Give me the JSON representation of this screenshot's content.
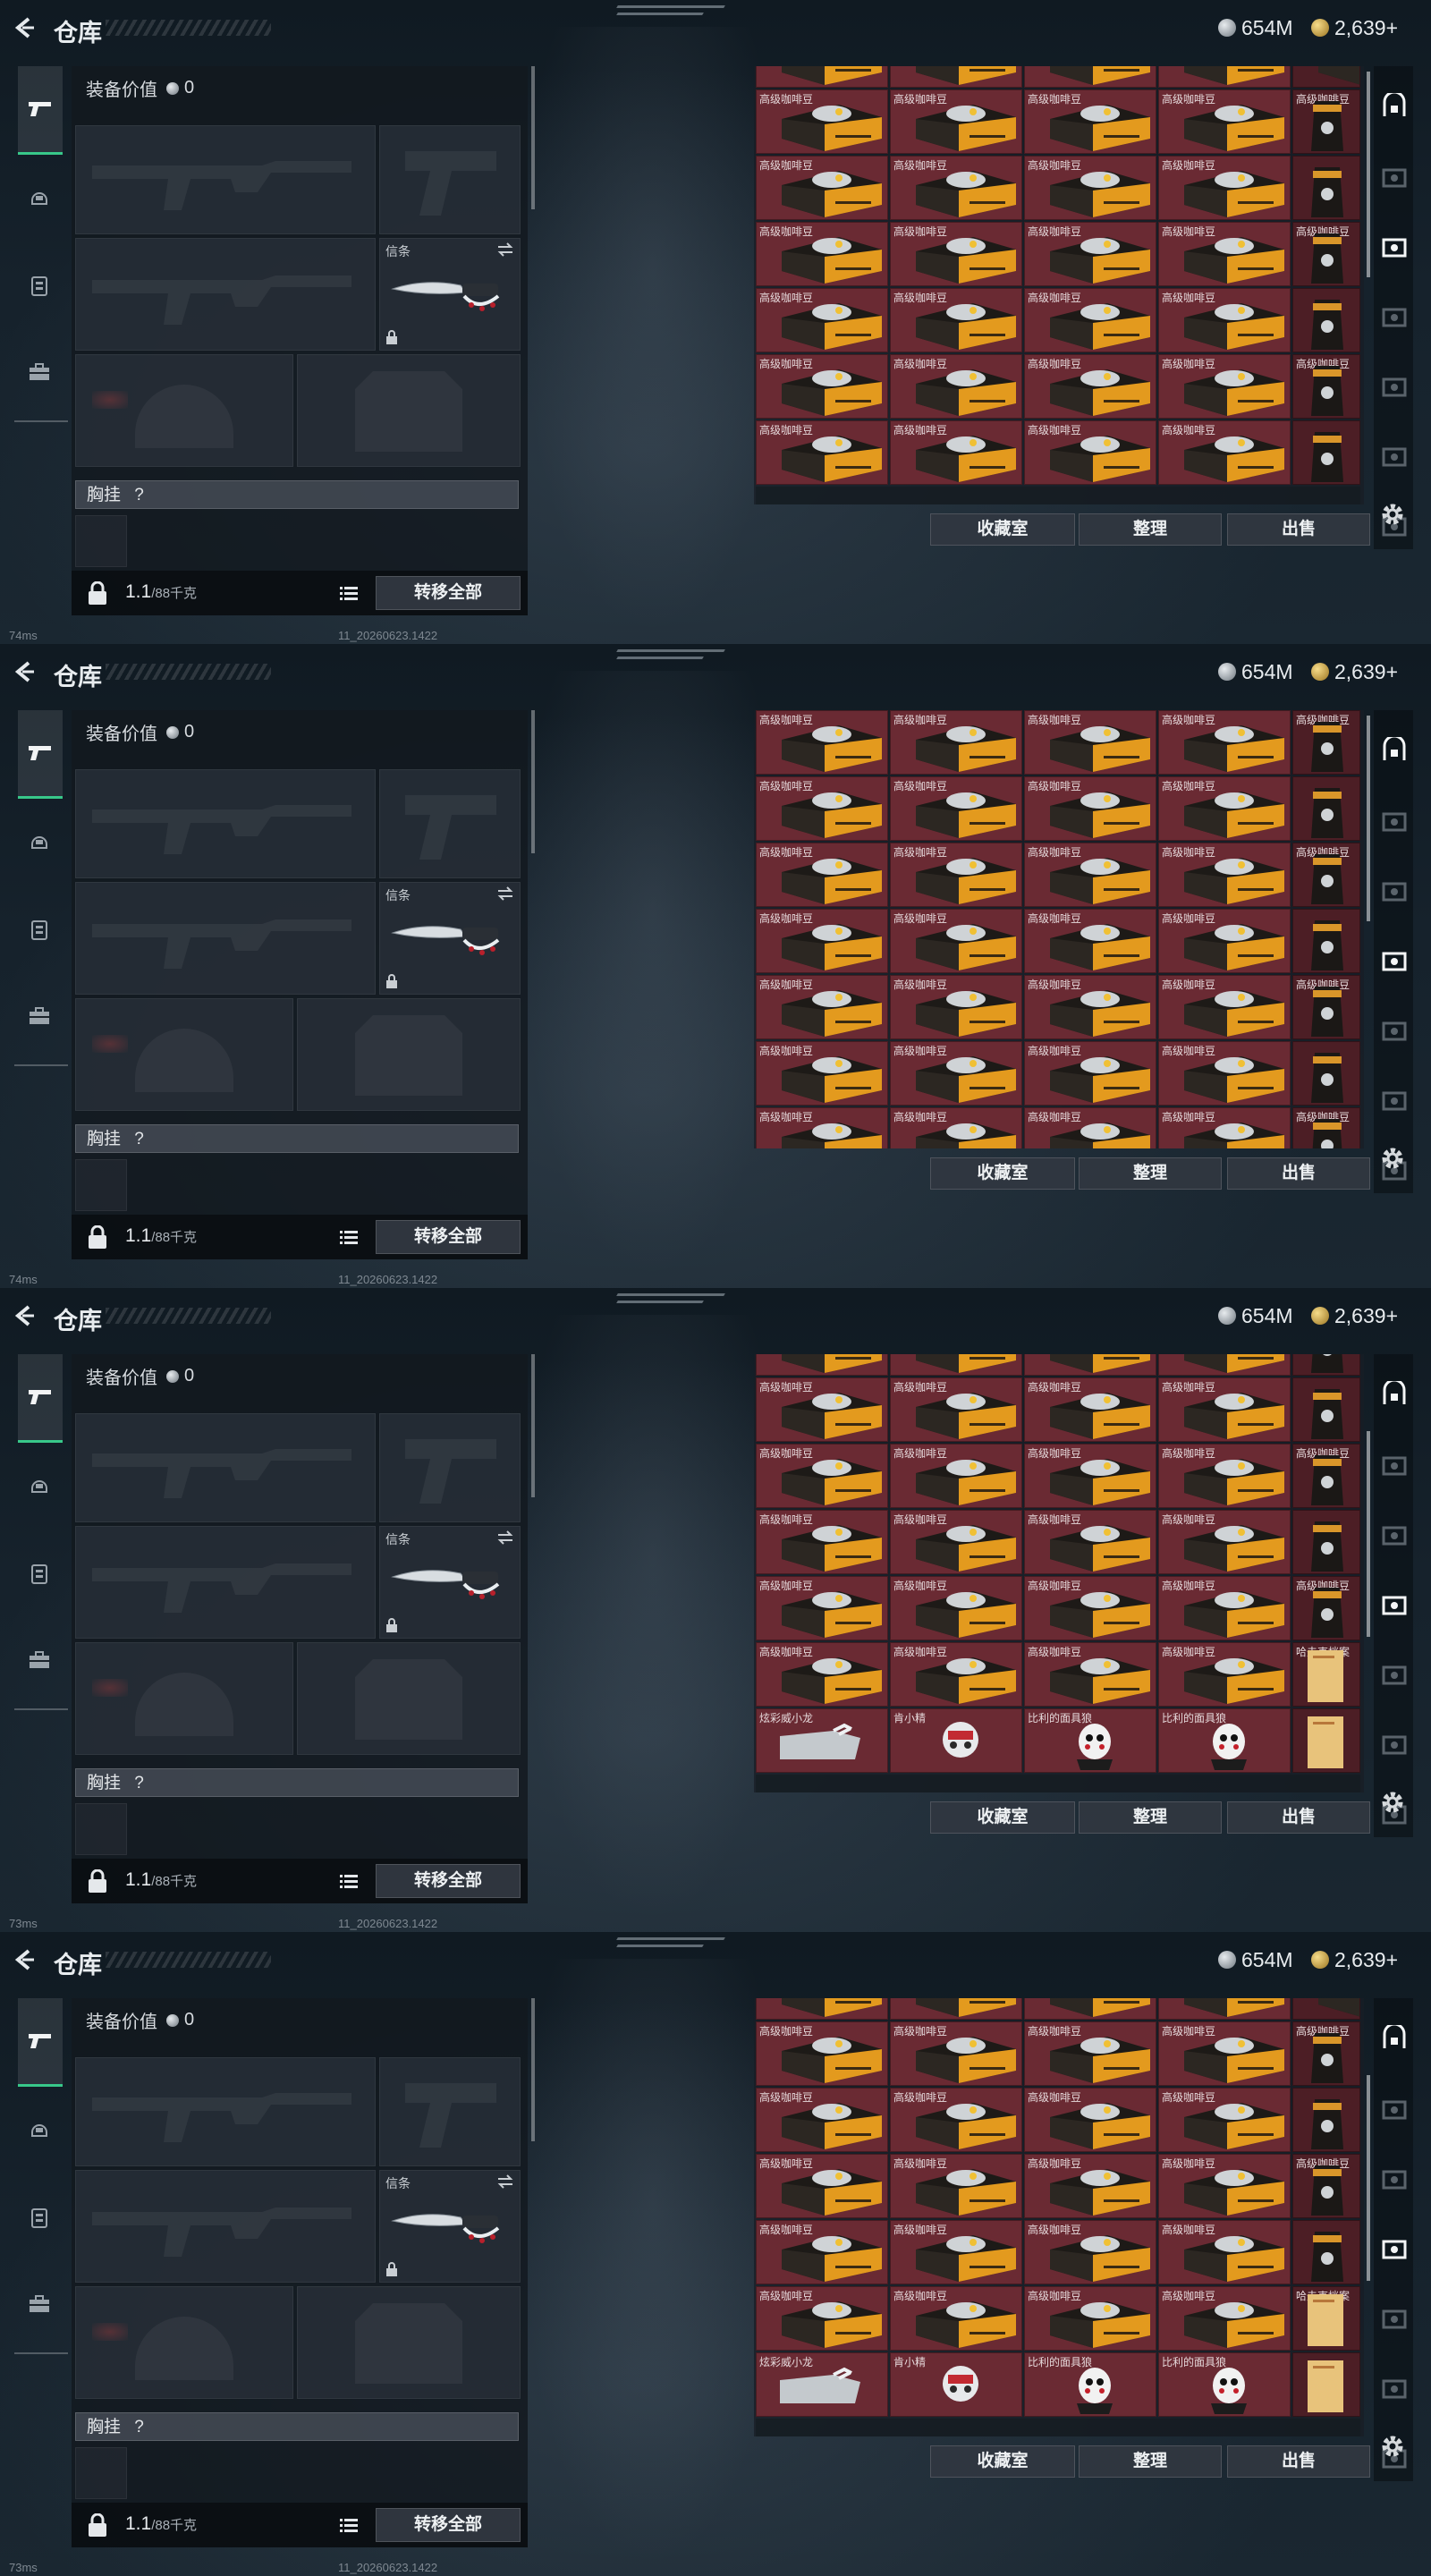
{
  "topbar": {
    "title": "仓库",
    "currency_silver": "654M",
    "currency_gold": "2,639",
    "gold_plus": "+"
  },
  "equipment": {
    "value_label": "装备价值",
    "value": "0",
    "knife_label": "信条",
    "chest_label": "胸挂",
    "chest_hint": "?",
    "weight": "1.1",
    "weight_max": "/88千克",
    "transfer_all": "转移全部"
  },
  "storage": {
    "buttons": {
      "collection": "收藏室",
      "organize": "整理",
      "sell": "出售"
    },
    "item_names": {
      "coffee": "高级咖啡豆",
      "file": "哈夫克档案",
      "gauntlet": "炫彩威小龙",
      "doll": "肯小精",
      "puppet": "比利的面具狼"
    }
  },
  "frames": [
    {
      "ping": "74ms",
      "build": "11_20260623.1422",
      "scroll_top": 0.0,
      "rows": [
        {
          "partial": true,
          "names": [
            "",
            "",
            "",
            "",
            ""
          ],
          "kinds": [
            "coffee",
            "coffee",
            "coffee",
            "coffee",
            "coffee"
          ]
        },
        {
          "names": [
            "coffee",
            "coffee",
            "coffee",
            "coffee",
            "coffee"
          ],
          "kinds": [
            "coffee",
            "coffee",
            "coffee",
            "coffee",
            "bag"
          ]
        },
        {
          "names": [
            "coffee",
            "coffee",
            "coffee",
            "coffee",
            ""
          ],
          "kinds": [
            "coffee",
            "coffee",
            "coffee",
            "coffee",
            "bag"
          ]
        },
        {
          "names": [
            "coffee",
            "coffee",
            "coffee",
            "coffee",
            "coffee"
          ],
          "kinds": [
            "coffee",
            "coffee",
            "coffee",
            "coffee",
            "bag"
          ]
        },
        {
          "names": [
            "coffee",
            "coffee",
            "coffee",
            "coffee",
            ""
          ],
          "kinds": [
            "coffee",
            "coffee",
            "coffee",
            "coffee",
            "bag"
          ]
        },
        {
          "names": [
            "coffee",
            "coffee",
            "coffee",
            "coffee",
            "coffee"
          ],
          "kinds": [
            "coffee",
            "coffee",
            "coffee",
            "coffee",
            "bag"
          ]
        },
        {
          "names": [
            "coffee",
            "coffee",
            "coffee",
            "coffee",
            ""
          ],
          "kinds": [
            "coffee",
            "coffee",
            "coffee",
            "coffee",
            "bag"
          ]
        }
      ]
    },
    {
      "ping": "74ms",
      "build": "11_20260623.1422",
      "scroll_top": 0.0,
      "rows": [
        {
          "names": [
            "coffee",
            "coffee",
            "coffee",
            "coffee",
            "coffee"
          ],
          "kinds": [
            "coffee",
            "coffee",
            "coffee",
            "coffee",
            "bag"
          ]
        },
        {
          "names": [
            "coffee",
            "coffee",
            "coffee",
            "coffee",
            ""
          ],
          "kinds": [
            "coffee",
            "coffee",
            "coffee",
            "coffee",
            "bag"
          ]
        },
        {
          "names": [
            "coffee",
            "coffee",
            "coffee",
            "coffee",
            "coffee"
          ],
          "kinds": [
            "coffee",
            "coffee",
            "coffee",
            "coffee",
            "bag"
          ]
        },
        {
          "names": [
            "coffee",
            "coffee",
            "coffee",
            "coffee",
            ""
          ],
          "kinds": [
            "coffee",
            "coffee",
            "coffee",
            "coffee",
            "bag"
          ]
        },
        {
          "names": [
            "coffee",
            "coffee",
            "coffee",
            "coffee",
            "coffee"
          ],
          "kinds": [
            "coffee",
            "coffee",
            "coffee",
            "coffee",
            "bag"
          ]
        },
        {
          "names": [
            "coffee",
            "coffee",
            "coffee",
            "coffee",
            ""
          ],
          "kinds": [
            "coffee",
            "coffee",
            "coffee",
            "coffee",
            "bag"
          ]
        },
        {
          "names": [
            "coffee",
            "coffee",
            "coffee",
            "coffee",
            "coffee"
          ],
          "kinds": [
            "coffee",
            "coffee",
            "coffee",
            "coffee",
            "bag"
          ]
        },
        {
          "names": [
            "coffee",
            "coffee",
            "coffee",
            "coffee",
            ""
          ],
          "kinds": [
            "coffee",
            "coffee",
            "coffee",
            "coffee",
            "bag"
          ]
        }
      ]
    },
    {
      "ping": "73ms",
      "build": "11_20260623.1422",
      "scroll_top": 0.0,
      "rows": [
        {
          "partial": true,
          "names": [
            "coffee",
            "coffee",
            "coffee",
            "coffee",
            "coffee"
          ],
          "kinds": [
            "coffee",
            "coffee",
            "coffee",
            "coffee",
            "bag"
          ]
        },
        {
          "names": [
            "coffee",
            "coffee",
            "coffee",
            "coffee",
            ""
          ],
          "kinds": [
            "coffee",
            "coffee",
            "coffee",
            "coffee",
            "bag"
          ]
        },
        {
          "names": [
            "coffee",
            "coffee",
            "coffee",
            "coffee",
            "coffee"
          ],
          "kinds": [
            "coffee",
            "coffee",
            "coffee",
            "coffee",
            "bag"
          ]
        },
        {
          "names": [
            "coffee",
            "coffee",
            "coffee",
            "coffee",
            ""
          ],
          "kinds": [
            "coffee",
            "coffee",
            "coffee",
            "coffee",
            "bag"
          ]
        },
        {
          "names": [
            "coffee",
            "coffee",
            "coffee",
            "coffee",
            "coffee"
          ],
          "kinds": [
            "coffee",
            "coffee",
            "coffee",
            "coffee",
            "bag"
          ]
        },
        {
          "names": [
            "coffee",
            "coffee",
            "coffee",
            "coffee",
            "file"
          ],
          "kinds": [
            "coffee",
            "coffee",
            "coffee",
            "coffee",
            "file"
          ]
        },
        {
          "names": [
            "gauntlet",
            "doll",
            "puppet",
            "puppet",
            ""
          ],
          "kinds": [
            "gauntlet",
            "doll",
            "puppet",
            "puppet",
            "file"
          ]
        }
      ]
    },
    {
      "ping": "73ms",
      "build": "11_20260623.1422",
      "scroll_top": 0.0,
      "rows": [
        {
          "partial": true,
          "names": [
            "",
            "",
            "",
            "",
            ""
          ],
          "kinds": [
            "coffee",
            "coffee",
            "coffee",
            "coffee",
            "coffee"
          ]
        },
        {
          "names": [
            "coffee",
            "coffee",
            "coffee",
            "coffee",
            "coffee"
          ],
          "kinds": [
            "coffee",
            "coffee",
            "coffee",
            "coffee",
            "bag"
          ]
        },
        {
          "names": [
            "coffee",
            "coffee",
            "coffee",
            "coffee",
            ""
          ],
          "kinds": [
            "coffee",
            "coffee",
            "coffee",
            "coffee",
            "bag"
          ]
        },
        {
          "names": [
            "coffee",
            "coffee",
            "coffee",
            "coffee",
            "coffee"
          ],
          "kinds": [
            "coffee",
            "coffee",
            "coffee",
            "coffee",
            "bag"
          ]
        },
        {
          "names": [
            "coffee",
            "coffee",
            "coffee",
            "coffee",
            ""
          ],
          "kinds": [
            "coffee",
            "coffee",
            "coffee",
            "coffee",
            "bag"
          ]
        },
        {
          "names": [
            "coffee",
            "coffee",
            "coffee",
            "coffee",
            "file"
          ],
          "kinds": [
            "coffee",
            "coffee",
            "coffee",
            "coffee",
            "file"
          ]
        },
        {
          "names": [
            "gauntlet",
            "doll",
            "puppet",
            "puppet",
            ""
          ],
          "kinds": [
            "gauntlet",
            "doll",
            "puppet",
            "puppet",
            "file"
          ]
        }
      ]
    }
  ],
  "colors": {
    "accent": "#38c88a",
    "cell": "#6a2a33",
    "panel": "#12181f"
  },
  "icons": {
    "left_nav": [
      "pistol-icon",
      "helmet-icon",
      "vest-icon",
      "briefcase-icon"
    ],
    "right_nav": [
      "safe-icon",
      "case-icon-1",
      "case-icon-4",
      "case-icon-5",
      "case-icon-6",
      "case-icon-7",
      "case-icon-8"
    ]
  }
}
